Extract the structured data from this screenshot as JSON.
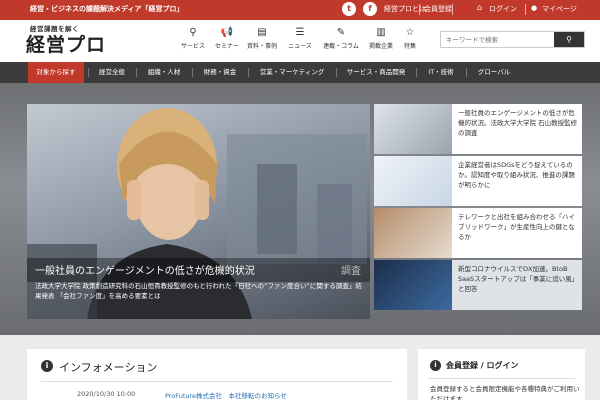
{
  "topbar": {
    "tagline": "経営・ビジネスの課題解決メディア「経営プロ」",
    "social_twitter": "t",
    "social_facebook": "f",
    "about": "経営プロとは",
    "register": "会員登録",
    "login": "ログイン",
    "mypage": "マイページ"
  },
  "header": {
    "logo_sub": "経営課題を解く",
    "logo_main": "経営プロ",
    "nav": [
      {
        "label": "サービス",
        "icon": "search-icon"
      },
      {
        "label": "セミナー",
        "icon": "megaphone-icon"
      },
      {
        "label": "資料・事例",
        "icon": "document-icon"
      },
      {
        "label": "ニュース",
        "icon": "news-icon"
      },
      {
        "label": "連載・コラム",
        "icon": "pen-icon"
      },
      {
        "label": "掲載企業",
        "icon": "book-icon"
      },
      {
        "label": "特集",
        "icon": "star-icon"
      }
    ],
    "search_placeholder": "キーワードで検索"
  },
  "catnav": {
    "find": "対象から探す",
    "items": [
      "経営全般",
      "組織・人材",
      "財務・資金",
      "営業・マーケティング",
      "サービス・商品開発",
      "IT・技術",
      "グローバル"
    ]
  },
  "hero": {
    "main": {
      "title": "一般社員のエンゲージメントの低さが危機的状況",
      "title_overlay": "調査",
      "description": "法政大学大学院 政策創造研究科の石山恒貴教授監修のもと行われた「日社への”ファン度合い”に関する調査」結果発表 「会社ファン度」を高める要素とは"
    },
    "side": [
      {
        "title": "一般社員のエンゲージメントの低さが危機的状況。法政大学大学院 石山教授監修の調査"
      },
      {
        "title": "企業経営者はSDGsをどう捉えているのか。認知度や取り組み状況、推進の課題が明らかに"
      },
      {
        "title": "テレワークと出社を組み合わせる「ハイブリッドワーク」が生産性向上の鍵となるか"
      },
      {
        "title": "新型コロナウイルスでDX加速。BtoB SaaSスタートアップは「事業に追い風」と回答"
      }
    ]
  },
  "info": {
    "title": "インフォメーション",
    "date": "2020/10/30 10:00",
    "link": "ProFuture株式会社　本社移転のお知らせ"
  },
  "member": {
    "title": "会員登録 / ログイン",
    "text": "会員登録すると会員限定機能や各種特典がご利用いただけます"
  }
}
